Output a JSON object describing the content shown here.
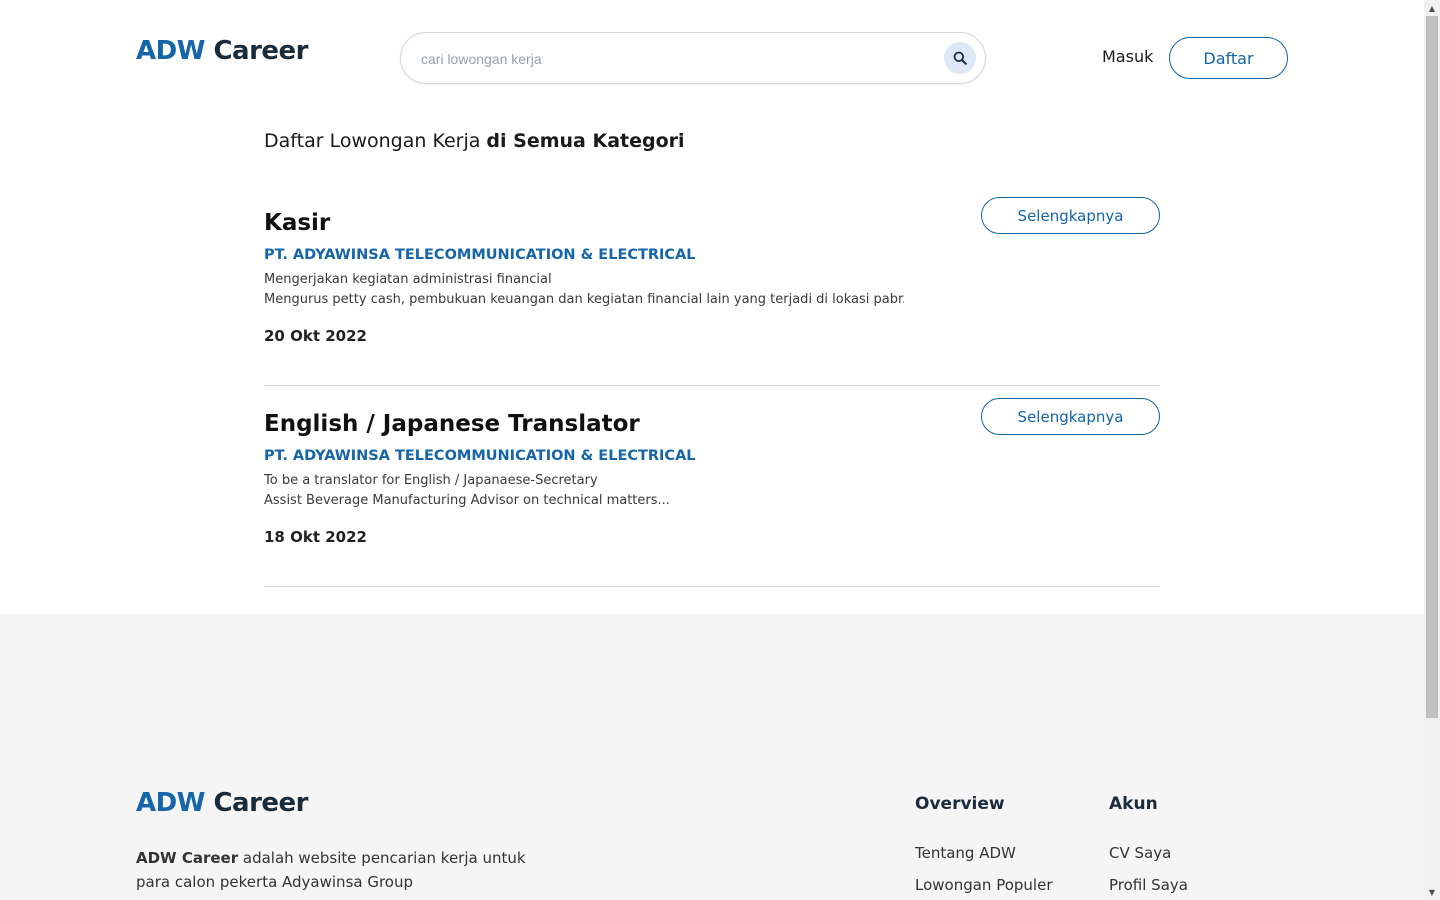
{
  "header": {
    "logo_part1": "ADW",
    "logo_part2": " Career",
    "search_placeholder": "cari lowongan kerja",
    "search_icon": "search-icon",
    "login_label": "Masuk",
    "register_label": "Daftar"
  },
  "listing": {
    "heading_prefix": "Daftar Lowongan Kerja ",
    "heading_bold": "di Semua Kategori"
  },
  "jobs": [
    {
      "title": "Kasir",
      "company": "PT. ADYAWINSA TELECOMMUNICATION & ELECTRICAL",
      "desc_line1": "Mengerjakan kegiatan administrasi financial",
      "desc_line2": "Mengurus petty cash, pembukuan keuangan dan kegiatan financial lain yang terjadi di lokasi pabr...",
      "date": "20 Okt 2022",
      "button_label": "Selengkapnya"
    },
    {
      "title": "English / Japanese Translator",
      "company": "PT. ADYAWINSA TELECOMMUNICATION & ELECTRICAL",
      "desc_line1": "To be a translator for English / Japanaese-Secretary",
      "desc_line2": "Assist Beverage Manufacturing Advisor on technical matters...",
      "date": "18 Okt 2022",
      "button_label": "Selengkapnya"
    }
  ],
  "footer": {
    "logo_part1": "ADW",
    "logo_part2": " Career",
    "about_brand": "ADW Career",
    "about_text": " adalah website pencarian kerja untuk para calon pekerta Adyawinsa Group",
    "col1_title": "Overview",
    "col1_links": [
      "Tentang ADW",
      "Lowongan Populer"
    ],
    "col2_title": "Akun",
    "col2_links": [
      "CV Saya",
      "Profil Saya"
    ]
  },
  "colors": {
    "brand_blue": "#1565a8",
    "footer_bg": "#f5f5f5"
  }
}
